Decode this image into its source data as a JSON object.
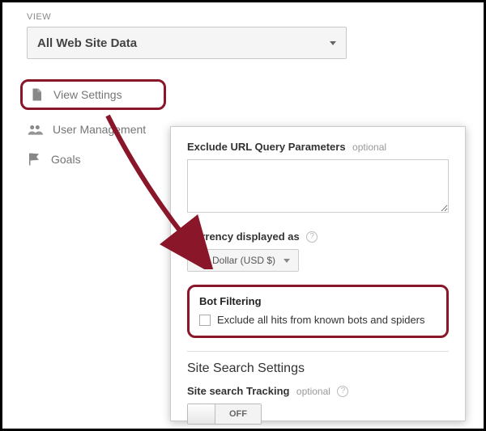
{
  "header": {
    "label": "VIEW",
    "selected": "All Web Site Data"
  },
  "sidebar": {
    "items": [
      {
        "label": "View Settings"
      },
      {
        "label": "User Management"
      },
      {
        "label": "Goals"
      }
    ]
  },
  "panel": {
    "exclude": {
      "label": "Exclude URL Query Parameters",
      "hint": "optional",
      "value": ""
    },
    "currency": {
      "label": "Currency displayed as",
      "selected": "US Dollar (USD $)"
    },
    "bot": {
      "title": "Bot Filtering",
      "checkbox_label": "Exclude all hits from known bots and spiders"
    },
    "search": {
      "section": "Site Search Settings",
      "tracking_label": "Site search Tracking",
      "tracking_hint": "optional",
      "toggle": "OFF"
    }
  }
}
